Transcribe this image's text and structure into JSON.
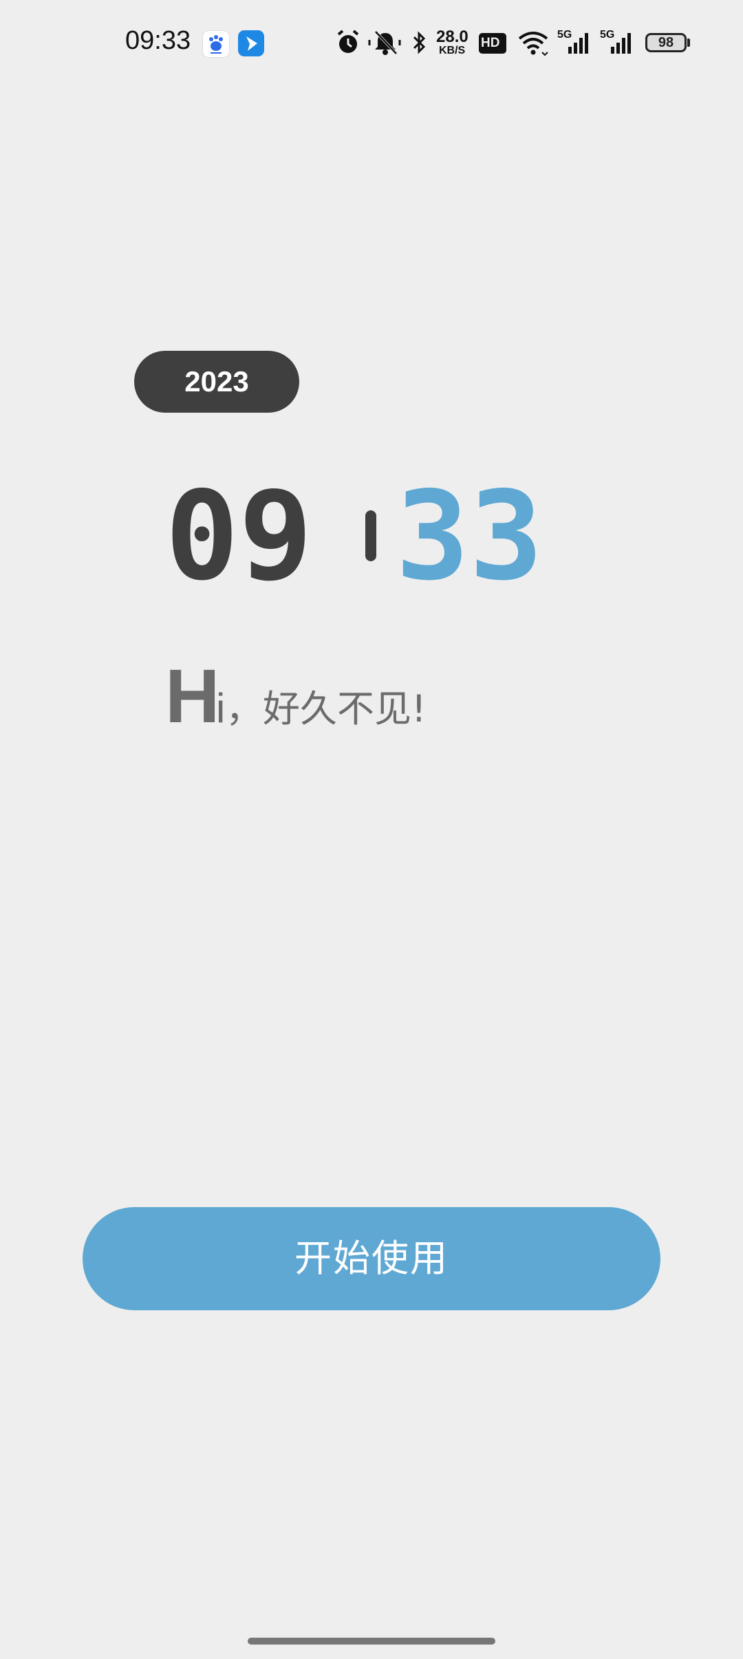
{
  "status_bar": {
    "time": "09:33",
    "net_speed_value": "28.0",
    "net_speed_unit": "KB/S",
    "hd_label": "HD",
    "signal_5g_1": "5G",
    "signal_5g_2": "5G",
    "battery": "98",
    "icons": [
      "baidu-app-icon",
      "feishu-app-icon",
      "alarm-icon",
      "mute-icon",
      "bluetooth-icon",
      "hd-icon",
      "wifi-icon",
      "signal-icon",
      "battery-icon"
    ]
  },
  "main": {
    "year": "2023",
    "clock": {
      "hours": "09",
      "minutes": "33"
    },
    "greeting": {
      "big_letter": "H",
      "small_letter": "i",
      "rest": "，好久不见!"
    },
    "start_button_label": "开始使用"
  },
  "colors": {
    "background": "#eeeeee",
    "dark": "#3f3f3f",
    "accent": "#5fa8d3",
    "greeting_text": "#6b6b6b"
  }
}
